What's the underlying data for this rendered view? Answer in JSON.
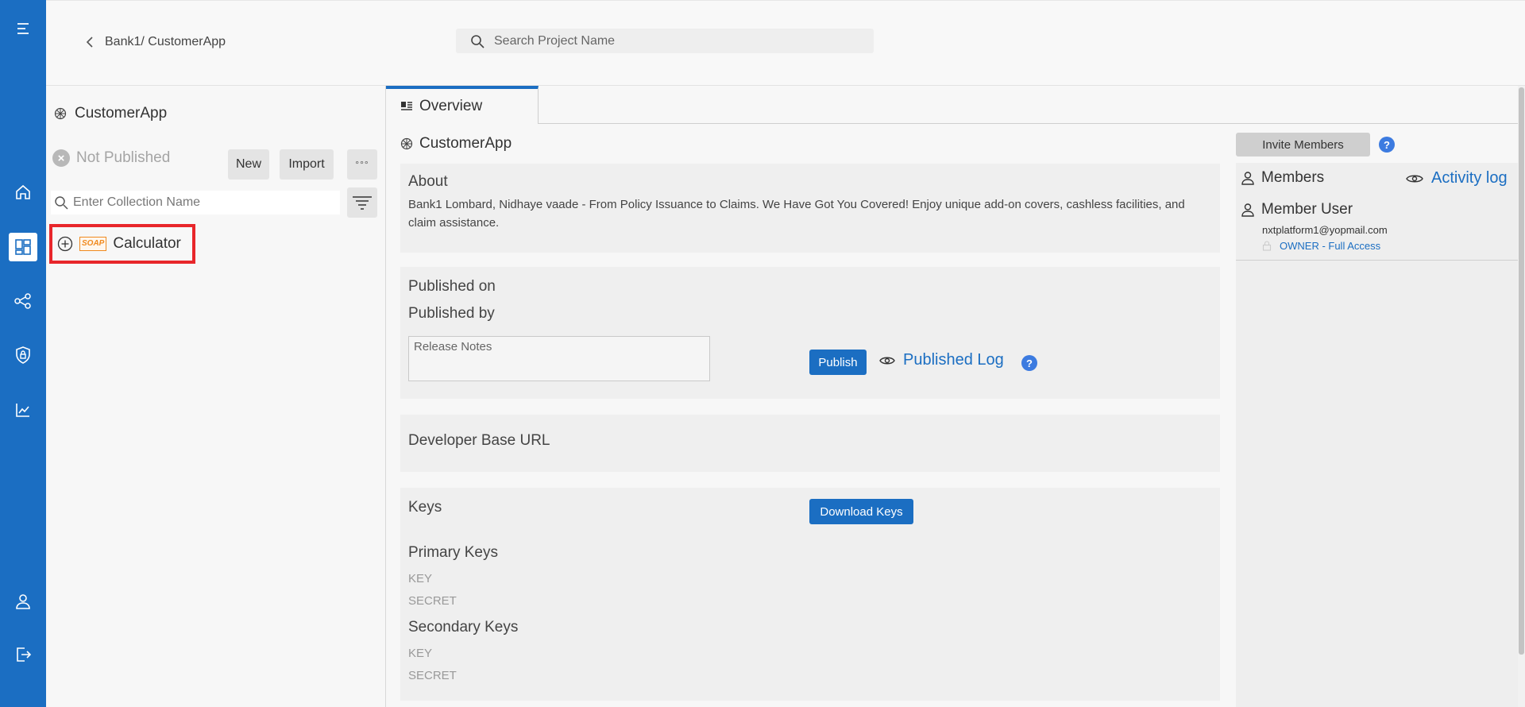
{
  "nav": {
    "icons": [
      "menu-icon",
      "home-icon",
      "dashboard-icon",
      "share-nodes-icon",
      "shield-icon",
      "analytics-icon",
      "user-icon",
      "logout-icon"
    ]
  },
  "header": {
    "breadcrumb": "Bank1/ CustomerApp",
    "search_placeholder": "Search Project Name"
  },
  "sidebar": {
    "app_name": "CustomerApp",
    "status": "Not Published",
    "new_label": "New",
    "import_label": "Import",
    "more_label": "°°°",
    "collection_placeholder": "Enter Collection Name",
    "collections": [
      {
        "badge": "SOAP",
        "label": "Calculator"
      }
    ]
  },
  "main": {
    "tab_label": "Overview",
    "title": "CustomerApp",
    "about": {
      "heading": "About",
      "text": "Bank1 Lombard, Nidhaye vaade - From Policy Issuance to Claims. We Have Got You Covered! Enjoy unique add-on covers, cashless facilities, and claim assistance."
    },
    "publish": {
      "published_on": "Published on",
      "published_by": "Published by",
      "release_placeholder": "Release Notes",
      "publish_label": "Publish",
      "log_label": "Published Log",
      "help": "?"
    },
    "developer": {
      "heading": "Developer Base URL"
    },
    "keys": {
      "heading": "Keys",
      "download_label": "Download Keys",
      "primary_heading": "Primary Keys",
      "secondary_heading": "Secondary Keys",
      "key_label": "KEY",
      "secret_label": "SECRET"
    }
  },
  "members": {
    "invite_label": "Invite Members",
    "help": "?",
    "heading": "Members",
    "activity_label": "Activity log",
    "user_name": "Member User",
    "user_email": "nxtplatform1@yopmail.com",
    "user_role": "OWNER - Full Access"
  },
  "colors": {
    "brand": "#1b6ec2",
    "highlight": "#e8262b",
    "soap": "#f08a1f"
  }
}
